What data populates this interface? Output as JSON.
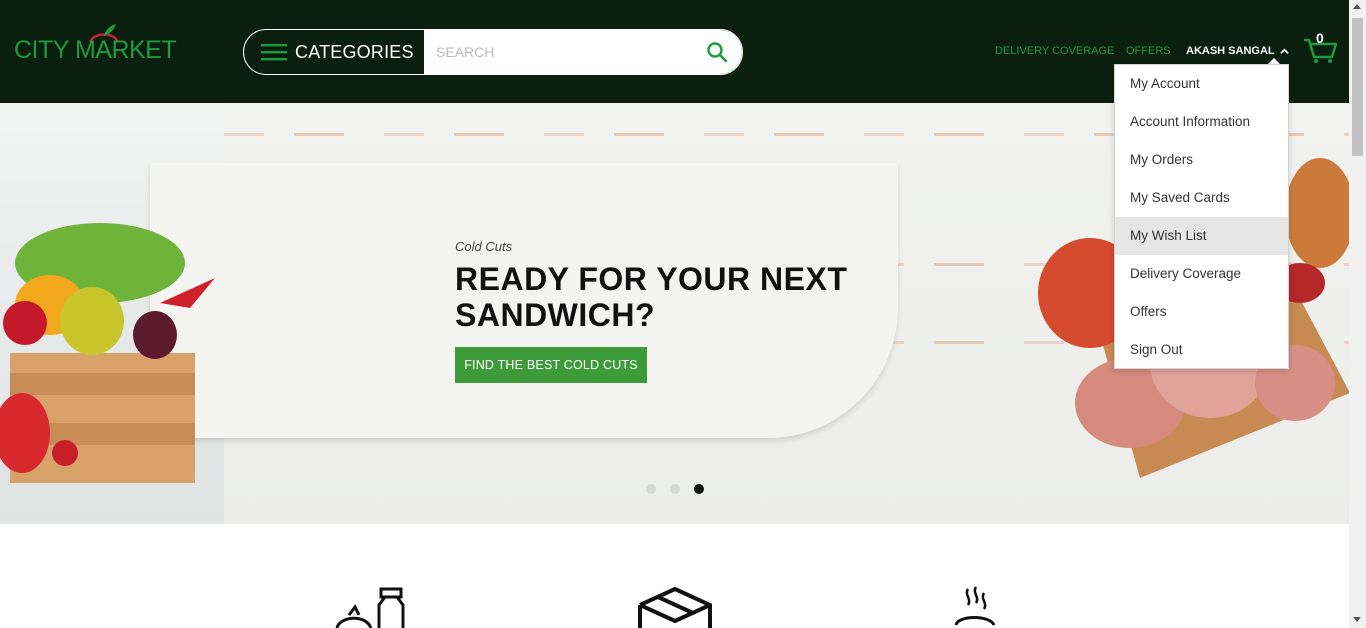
{
  "brand": {
    "name": "CITY MARKET"
  },
  "header": {
    "categories_label": "CATEGORIES",
    "search_placeholder": "SEARCH",
    "nav": {
      "delivery": "DELIVERY COVERAGE",
      "offers": "OFFERS",
      "user": "AKASH SANGAL"
    },
    "cart_count": "0"
  },
  "user_menu": {
    "items": [
      {
        "label": "My Account"
      },
      {
        "label": "Account Information"
      },
      {
        "label": "My Orders"
      },
      {
        "label": "My Saved Cards"
      },
      {
        "label": "My Wish List"
      },
      {
        "label": "Delivery Coverage"
      },
      {
        "label": "Offers"
      },
      {
        "label": "Sign Out"
      }
    ],
    "hovered_index": 4
  },
  "hero": {
    "kicker": "Cold Cuts",
    "title": "READY FOR YOUR NEXT SANDWICH?",
    "cta": "FIND THE BEST COLD CUTS",
    "slide_count": 3,
    "active_slide": 3
  },
  "colors": {
    "header_bg": "#0b1f0f",
    "accent_green": "#1f9b3f",
    "cta_green": "#3d9b3a"
  },
  "icons": [
    "menu-icon",
    "search-icon",
    "chevron-up-icon",
    "cart-icon",
    "grocery-icon",
    "box-icon",
    "hot-food-icon"
  ]
}
